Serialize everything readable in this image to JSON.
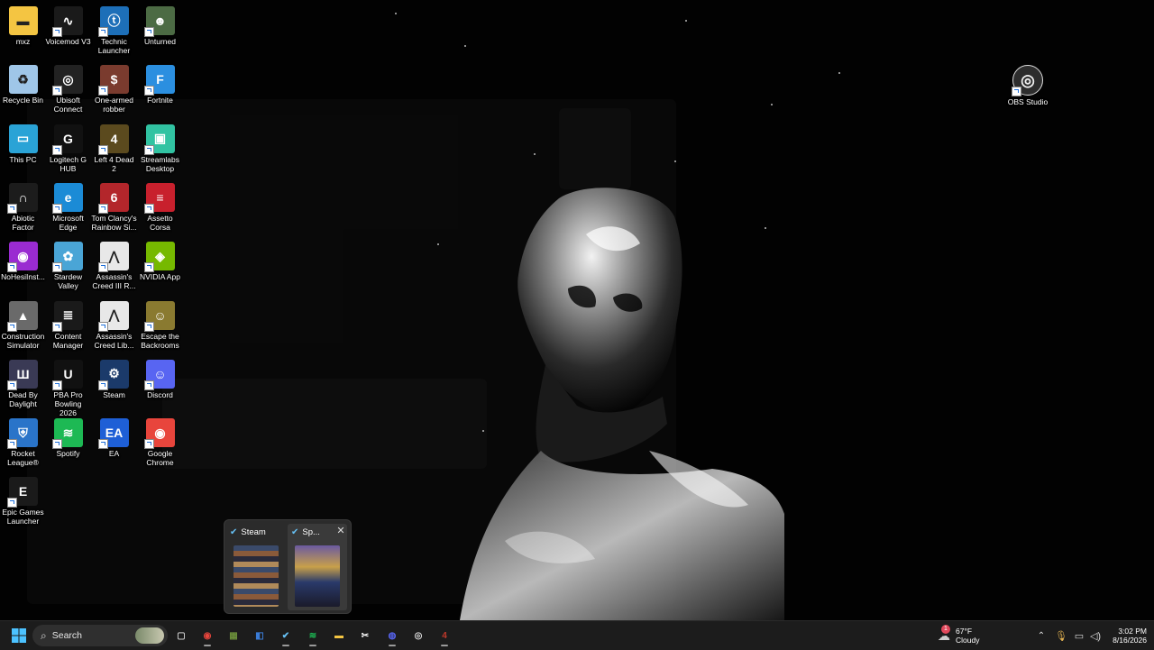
{
  "desktop": {
    "icons": [
      {
        "label": "mxz",
        "icon": "folder-icon",
        "color": "#f4c542"
      },
      {
        "label": "Voicemod V3",
        "icon": "voicemod-icon",
        "color": "#1a1a1a"
      },
      {
        "label": "Technic Launcher",
        "icon": "technic-icon",
        "color": "#1d6fb8"
      },
      {
        "label": "Unturned",
        "icon": "unturned-icon",
        "color": "#4c6b44"
      },
      {
        "label": "Recycle Bin",
        "icon": "recycle-bin-icon",
        "color": "#9fc6e8"
      },
      {
        "label": "Ubisoft Connect",
        "icon": "ubisoft-icon",
        "color": "#222222"
      },
      {
        "label": "One-armed robber",
        "icon": "one-armed-robber-icon",
        "color": "#7a3b2e"
      },
      {
        "label": "Fortnite",
        "icon": "fortnite-icon",
        "color": "#2b8fe0"
      },
      {
        "label": "This PC",
        "icon": "monitor-icon",
        "color": "#2aa3d6"
      },
      {
        "label": "Logitech G HUB",
        "icon": "logitech-icon",
        "color": "#111111"
      },
      {
        "label": "Left 4 Dead 2",
        "icon": "left4dead-icon",
        "color": "#5b4a1e"
      },
      {
        "label": "Streamlabs Desktop",
        "icon": "streamlabs-icon",
        "color": "#31c3a2"
      },
      {
        "label": "Abiotic Factor",
        "icon": "abiotic-icon",
        "color": "#1c1c1c"
      },
      {
        "label": "Microsoft Edge",
        "icon": "edge-icon",
        "color": "#1b8bd6"
      },
      {
        "label": "Tom Clancy's Rainbow Si...",
        "icon": "rainbow-six-icon",
        "color": "#b3262b"
      },
      {
        "label": "Assetto Corsa",
        "icon": "assetto-icon",
        "color": "#c8202d"
      },
      {
        "label": "NoHesiInst...",
        "icon": "nohesi-icon",
        "color": "#9a2bd1"
      },
      {
        "label": "Stardew Valley",
        "icon": "stardew-icon",
        "color": "#4aa5d6"
      },
      {
        "label": "Assassin's Creed III R...",
        "icon": "assassins-creed-icon",
        "color": "#e8e8e8"
      },
      {
        "label": "NVIDIA App",
        "icon": "nvidia-icon",
        "color": "#76b900"
      },
      {
        "label": "Construction Simulator",
        "icon": "construction-icon",
        "color": "#6a6a6a"
      },
      {
        "label": "Content Manager",
        "icon": "content-manager-icon",
        "color": "#1a1a1a"
      },
      {
        "label": "Assassin's Creed Lib...",
        "icon": "assassins-creed-icon",
        "color": "#e8e8e8"
      },
      {
        "label": "Escape the Backrooms",
        "icon": "backrooms-icon",
        "color": "#8a7a30"
      },
      {
        "label": "Dead By Daylight",
        "icon": "dbd-icon",
        "color": "#3a3a55"
      },
      {
        "label": "PBA Pro Bowling 2026",
        "icon": "unreal-icon",
        "color": "#111111"
      },
      {
        "label": "Steam",
        "icon": "steam-icon",
        "color": "#1b3a6a"
      },
      {
        "label": "Discord",
        "icon": "discord-icon",
        "color": "#5865f2"
      },
      {
        "label": "Rocket League®",
        "icon": "rocket-league-icon",
        "color": "#2a74c9"
      },
      {
        "label": "Spotify",
        "icon": "spotify-icon",
        "color": "#1db954"
      },
      {
        "label": "EA",
        "icon": "ea-icon",
        "color": "#1e5fd6"
      },
      {
        "label": "Google Chrome",
        "icon": "chrome-icon",
        "color": "#e8453c"
      },
      {
        "label": "Epic Games Launcher",
        "icon": "epic-icon",
        "color": "#1a1a1a"
      },
      {
        "label": "OBS Studio",
        "icon": "obs-icon",
        "color": "#3a3a3a"
      }
    ]
  },
  "popup": {
    "cards": [
      {
        "title": "Steam",
        "icon": "steam-icon"
      },
      {
        "title": "Sp...",
        "icon": "steam-icon"
      }
    ],
    "close_glyph": "✕"
  },
  "taskbar": {
    "search_label": "Search",
    "apps": [
      {
        "name": "task-view",
        "icon": "task-view-icon",
        "color": "#cccccc",
        "glyph": "▢"
      },
      {
        "name": "chrome",
        "icon": "chrome-icon",
        "color": "#e8453c",
        "glyph": "◉"
      },
      {
        "name": "minecraft",
        "icon": "minecraft-icon",
        "color": "#6b8e3a",
        "glyph": "▦"
      },
      {
        "name": "store",
        "icon": "store-icon",
        "color": "#3a7bd5",
        "glyph": "◧"
      },
      {
        "name": "steam",
        "icon": "steam-icon",
        "color": "#66c0f4",
        "glyph": "✔"
      },
      {
        "name": "spotify",
        "icon": "spotify-icon",
        "color": "#1db954",
        "glyph": "≋"
      },
      {
        "name": "file-explorer",
        "icon": "folder-icon",
        "color": "#f4c542",
        "glyph": "▬"
      },
      {
        "name": "capcut",
        "icon": "capcut-icon",
        "color": "#ffffff",
        "glyph": "✂"
      },
      {
        "name": "discord",
        "icon": "discord-icon",
        "color": "#5865f2",
        "glyph": "◍"
      },
      {
        "name": "obs",
        "icon": "obs-icon",
        "color": "#dddddd",
        "glyph": "◎"
      },
      {
        "name": "left4dead",
        "icon": "left4dead-icon",
        "color": "#c0392b",
        "glyph": "4"
      }
    ],
    "weather": {
      "temp": "67°F",
      "condition": "Cloudy",
      "badge": "1"
    },
    "clock": {
      "time": "3:02 PM",
      "date": "8/16/2026"
    }
  }
}
